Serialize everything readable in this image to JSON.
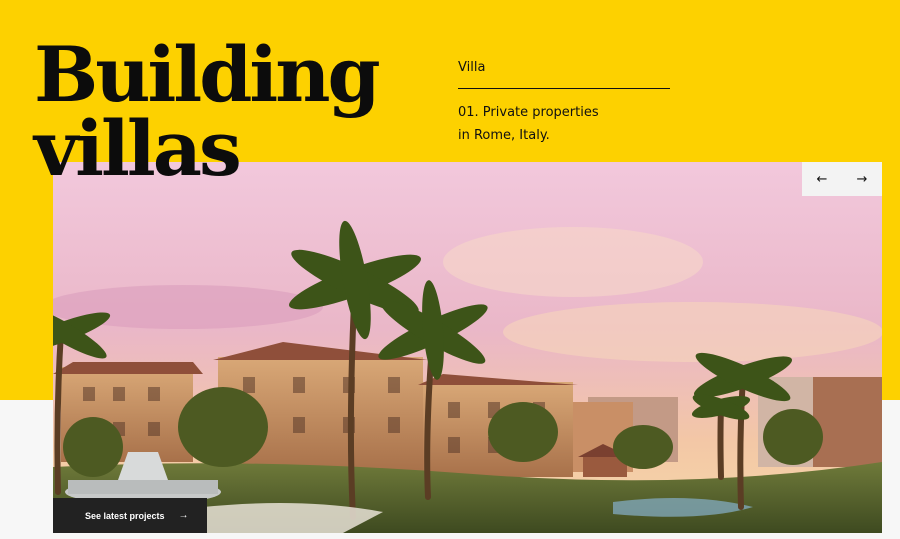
{
  "hero": {
    "title_line1": "Building",
    "title_line2": "villas"
  },
  "info": {
    "category": "Villa",
    "description": "01. Private properties\nin Rome, Italy."
  },
  "slider": {
    "prev_icon": "←",
    "next_icon": "→"
  },
  "cta": {
    "label": "See latest projects",
    "icon": "→"
  },
  "colors": {
    "accent": "#fdd100",
    "dark": "#222222"
  }
}
